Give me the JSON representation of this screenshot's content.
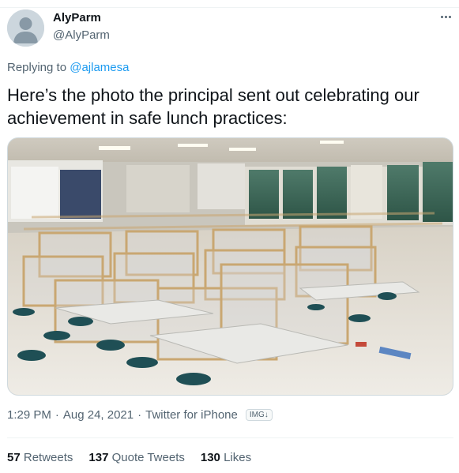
{
  "tweet": {
    "author": {
      "display_name": "AlyParm",
      "handle": "@AlyParm"
    },
    "replying_prefix": "Replying to",
    "replying_to": "@ajlamesa",
    "text": "Here’s the photo the principal sent out celebrating our achievement in safe lunch practices:",
    "media": {
      "kind": "photo",
      "subject": "cafeteria-with-plexiglass-dividers"
    },
    "time": "1:29 PM",
    "date": "Aug 24, 2021",
    "separator": "·",
    "source": "Twitter for iPhone",
    "badge": "IMG↓",
    "stats": {
      "retweets_count": "57",
      "retweets_label": "Retweets",
      "quote_count": "137",
      "quote_label": "Quote Tweets",
      "likes_count": "130",
      "likes_label": "Likes"
    }
  },
  "colors": {
    "text": "#0f1419",
    "secondary": "#536471",
    "link": "#1d9bf0",
    "border": "#eff3f4"
  },
  "icons": {
    "more": "ellipsis-icon",
    "avatar": "default-avatar-icon"
  }
}
